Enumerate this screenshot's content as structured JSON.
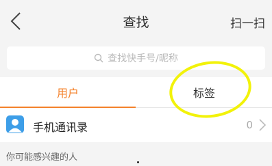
{
  "header": {
    "back_icon": "chevron-left-icon",
    "title": "查找",
    "scan_label": "扫一扫"
  },
  "search": {
    "icon": "search-icon",
    "placeholder": "查找快手号/昵称"
  },
  "tabs": [
    {
      "label": "用户",
      "active": true
    },
    {
      "label": "标签",
      "active": false
    }
  ],
  "contacts": {
    "icon": "contacts-icon",
    "label": "手机通讯录",
    "count": "0",
    "chevron": "chevron-right-icon"
  },
  "suggestions": {
    "label": "你可能感兴趣的人"
  },
  "colors": {
    "accent": "#f4812a",
    "annotation": "#f2f20a",
    "contacts_icon": "#3d9ee8"
  }
}
